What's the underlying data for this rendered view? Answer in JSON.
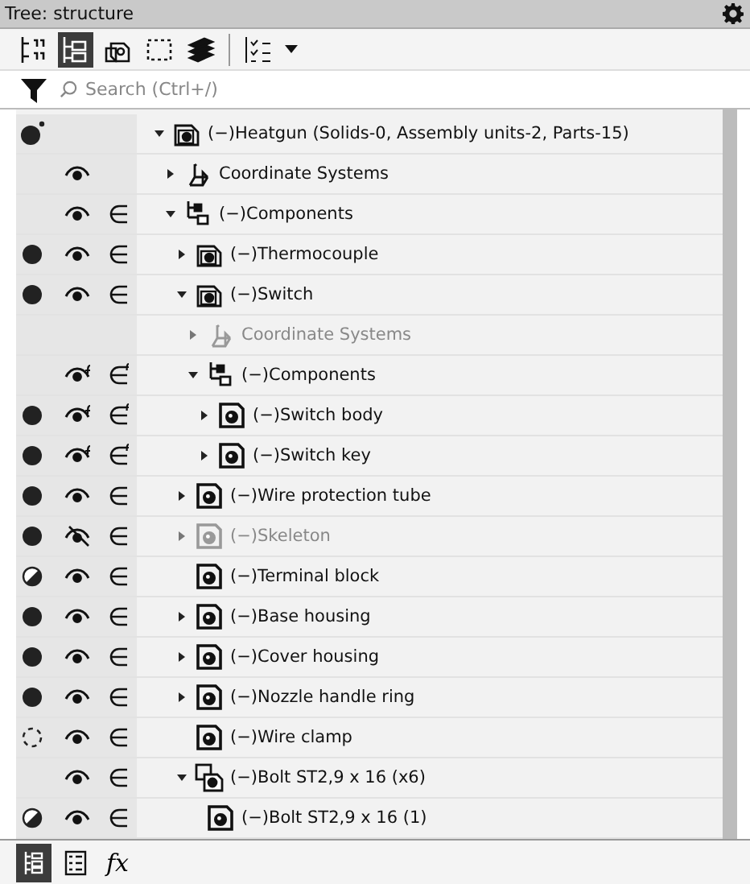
{
  "window": {
    "title": "Tree: structure"
  },
  "toolbar": [
    {
      "kind": "tree-numbers",
      "selected": false
    },
    {
      "kind": "tree-structure",
      "selected": true
    },
    {
      "kind": "assembly",
      "selected": false
    },
    {
      "kind": "selection-box",
      "selected": false
    },
    {
      "kind": "layers",
      "selected": false
    },
    {
      "kind": "task-list",
      "selected": false
    }
  ],
  "search": {
    "placeholder": "Search (Ctrl+/)"
  },
  "tree": [
    {
      "label": "(−)Heatgun (Solids-0, Assembly units-2, Parts-15)",
      "kind": "assembly",
      "expanded": true,
      "state": {
        "kind": "root"
      },
      "dimmed": false,
      "children": [
        {
          "label": "Coordinate Systems",
          "kind": "coordinates",
          "expanded": false,
          "eye": {
            "kind": "shown"
          },
          "dimmed": false
        },
        {
          "label": "(−)Components",
          "kind": "components",
          "expanded": true,
          "eye": {
            "kind": "shown"
          },
          "include": {
            "kind": "in"
          },
          "dimmed": false,
          "children": [
            {
              "label": "(−)Thermocouple",
              "kind": "assembly",
              "expanded": false,
              "state": {
                "kind": "full"
              },
              "eye": {
                "kind": "shown"
              },
              "include": {
                "kind": "in"
              },
              "dimmed": false
            },
            {
              "label": "(−)Switch",
              "kind": "assembly",
              "expanded": true,
              "state": {
                "kind": "full"
              },
              "eye": {
                "kind": "shown"
              },
              "include": {
                "kind": "in"
              },
              "dimmed": false,
              "children": [
                {
                  "label": "Coordinate Systems",
                  "kind": "coordinates",
                  "expanded": false,
                  "dimmed": true
                },
                {
                  "label": "(−)Components",
                  "kind": "components",
                  "expanded": true,
                  "eye": {
                    "kind": "shown-local"
                  },
                  "include": {
                    "kind": "in-local"
                  },
                  "dimmed": false,
                  "children": [
                    {
                      "label": "(−)Switch body",
                      "kind": "part",
                      "expanded": false,
                      "state": {
                        "kind": "full"
                      },
                      "eye": {
                        "kind": "shown-local"
                      },
                      "include": {
                        "kind": "in-local"
                      },
                      "dimmed": false
                    },
                    {
                      "label": "(−)Switch key",
                      "kind": "part",
                      "expanded": false,
                      "state": {
                        "kind": "full"
                      },
                      "eye": {
                        "kind": "shown-local"
                      },
                      "include": {
                        "kind": "in-local"
                      },
                      "dimmed": false
                    }
                  ]
                }
              ]
            },
            {
              "label": "(−)Wire protection tube",
              "kind": "part",
              "expanded": false,
              "state": {
                "kind": "full"
              },
              "eye": {
                "kind": "shown"
              },
              "include": {
                "kind": "in"
              },
              "dimmed": false
            },
            {
              "label": "(−)Skeleton",
              "kind": "part",
              "expanded": false,
              "state": {
                "kind": "full"
              },
              "eye": {
                "kind": "hidden"
              },
              "include": {
                "kind": "in"
              },
              "dimmed": true
            },
            {
              "label": "(−)Terminal block",
              "kind": "part",
              "state": {
                "kind": "half"
              },
              "eye": {
                "kind": "shown"
              },
              "include": {
                "kind": "in"
              },
              "dimmed": false
            },
            {
              "label": "(−)Base housing",
              "kind": "part",
              "expanded": false,
              "state": {
                "kind": "full"
              },
              "eye": {
                "kind": "shown"
              },
              "include": {
                "kind": "in"
              },
              "dimmed": false
            },
            {
              "label": "(−)Cover housing",
              "kind": "part",
              "expanded": false,
              "state": {
                "kind": "full"
              },
              "eye": {
                "kind": "shown"
              },
              "include": {
                "kind": "in"
              },
              "dimmed": false
            },
            {
              "label": "(−)Nozzle handle ring",
              "kind": "part",
              "expanded": false,
              "state": {
                "kind": "full"
              },
              "eye": {
                "kind": "shown"
              },
              "include": {
                "kind": "in"
              },
              "dimmed": false
            },
            {
              "label": "(−)Wire clamp",
              "kind": "part",
              "state": {
                "kind": "empty"
              },
              "eye": {
                "kind": "shown"
              },
              "include": {
                "kind": "in"
              },
              "dimmed": false
            },
            {
              "label": "(−)Bolt ST2,9 x 16 (x6)",
              "kind": "part-group",
              "expanded": true,
              "eye": {
                "kind": "shown"
              },
              "include": {
                "kind": "in"
              },
              "dimmed": false,
              "children": [
                {
                  "label": "(−)Bolt ST2,9 x 16 (1)",
                  "kind": "part",
                  "state": {
                    "kind": "half"
                  },
                  "eye": {
                    "kind": "shown"
                  },
                  "include": {
                    "kind": "in"
                  },
                  "dimmed": false
                }
              ]
            }
          ]
        }
      ]
    }
  ],
  "bottom_tabs": [
    {
      "kind": "tree",
      "selected": true
    },
    {
      "kind": "properties",
      "selected": false
    },
    {
      "kind": "formula",
      "label": "fx",
      "selected": false
    }
  ]
}
